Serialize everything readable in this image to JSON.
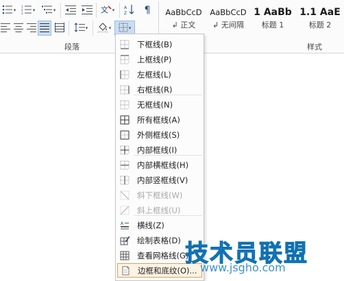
{
  "ribbon": {
    "paragraph_label": "段落",
    "styles_label": "样式",
    "styles": [
      {
        "sample": "AaBbCcD",
        "name": "↲ 正文"
      },
      {
        "sample": "AaBbCcD",
        "name": "↲ 无间隔"
      },
      {
        "sample": "1 AaBb",
        "name": "标题 1"
      },
      {
        "sample": "1.1 AaE",
        "name": "标题 2"
      }
    ]
  },
  "menu": {
    "items": [
      {
        "label": "下框线(B)",
        "icon": "border-bottom-icon",
        "disabled": false
      },
      {
        "label": "上框线(P)",
        "icon": "border-top-icon",
        "disabled": false
      },
      {
        "label": "左框线(L)",
        "icon": "border-left-icon",
        "disabled": false
      },
      {
        "label": "右框线(R)",
        "icon": "border-right-icon",
        "disabled": false
      },
      {
        "label": "无框线(N)",
        "icon": "border-none-icon",
        "disabled": false
      },
      {
        "label": "所有框线(A)",
        "icon": "border-all-icon",
        "disabled": false
      },
      {
        "label": "外侧框线(S)",
        "icon": "border-outside-icon",
        "disabled": false
      },
      {
        "label": "内部框线(I)",
        "icon": "border-inside-icon",
        "disabled": false
      },
      {
        "label": "内部横框线(H)",
        "icon": "border-inside-horizontal-icon",
        "disabled": false
      },
      {
        "label": "内部竖框线(V)",
        "icon": "border-inside-vertical-icon",
        "disabled": false
      },
      {
        "label": "斜下框线(W)",
        "icon": "diagonal-down-border-icon",
        "disabled": true
      },
      {
        "label": "斜上框线(U)",
        "icon": "diagonal-up-border-icon",
        "disabled": true
      },
      {
        "label": "横线(Z)",
        "icon": "horizontal-line-icon",
        "disabled": false
      },
      {
        "label": "绘制表格(D)",
        "icon": "draw-table-icon",
        "disabled": false
      },
      {
        "label": "查看网格线(G)",
        "icon": "view-gridlines-icon",
        "disabled": false
      },
      {
        "label": "边框和底纹(O)...",
        "icon": "borders-shading-icon",
        "disabled": false
      }
    ]
  },
  "watermark": {
    "title": "技术员联盟",
    "url": "www.jsgho.com"
  }
}
